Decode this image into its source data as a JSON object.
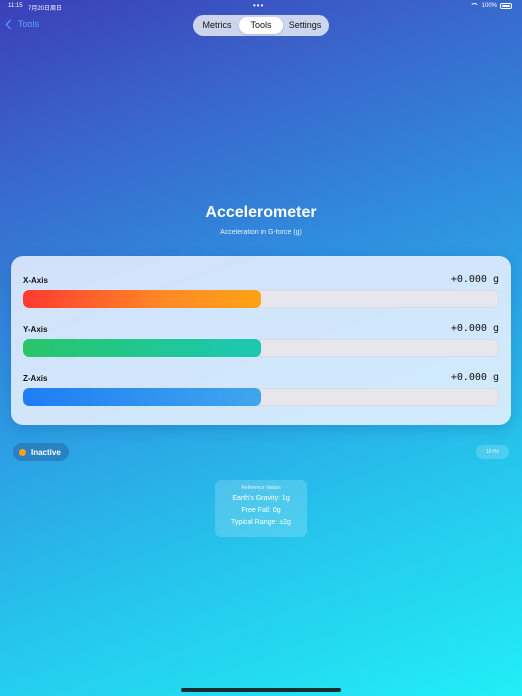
{
  "status_bar": {
    "time": "11:15",
    "date": "7月20日周日",
    "battery": "100%"
  },
  "nav": {
    "back_label": "Tools"
  },
  "segments": [
    {
      "label": "Metrics",
      "active": false
    },
    {
      "label": "Tools",
      "active": true
    },
    {
      "label": "Settings",
      "active": false
    }
  ],
  "page": {
    "title": "Accelerometer",
    "subtitle": "Acceleration in G-force (g)"
  },
  "axes": [
    {
      "label": "X-Axis",
      "value": "+0.000 g",
      "fill_fraction": 0.5
    },
    {
      "label": "Y-Axis",
      "value": "+0.000 g",
      "fill_fraction": 0.5
    },
    {
      "label": "Z-Axis",
      "value": "+0.000 g",
      "fill_fraction": 0.5
    }
  ],
  "status": {
    "label": "Inactive",
    "color": "#ff9f1a",
    "rate": "10 Hz"
  },
  "reference": {
    "heading": "Reference Values",
    "lines": [
      "Earth's Gravity: 1g",
      "Free Fall: 0g",
      "Typical Range: ±2g"
    ]
  },
  "icons": {
    "back": "chevron-left-icon",
    "wifi": "wifi-icon",
    "battery": "battery-icon"
  }
}
